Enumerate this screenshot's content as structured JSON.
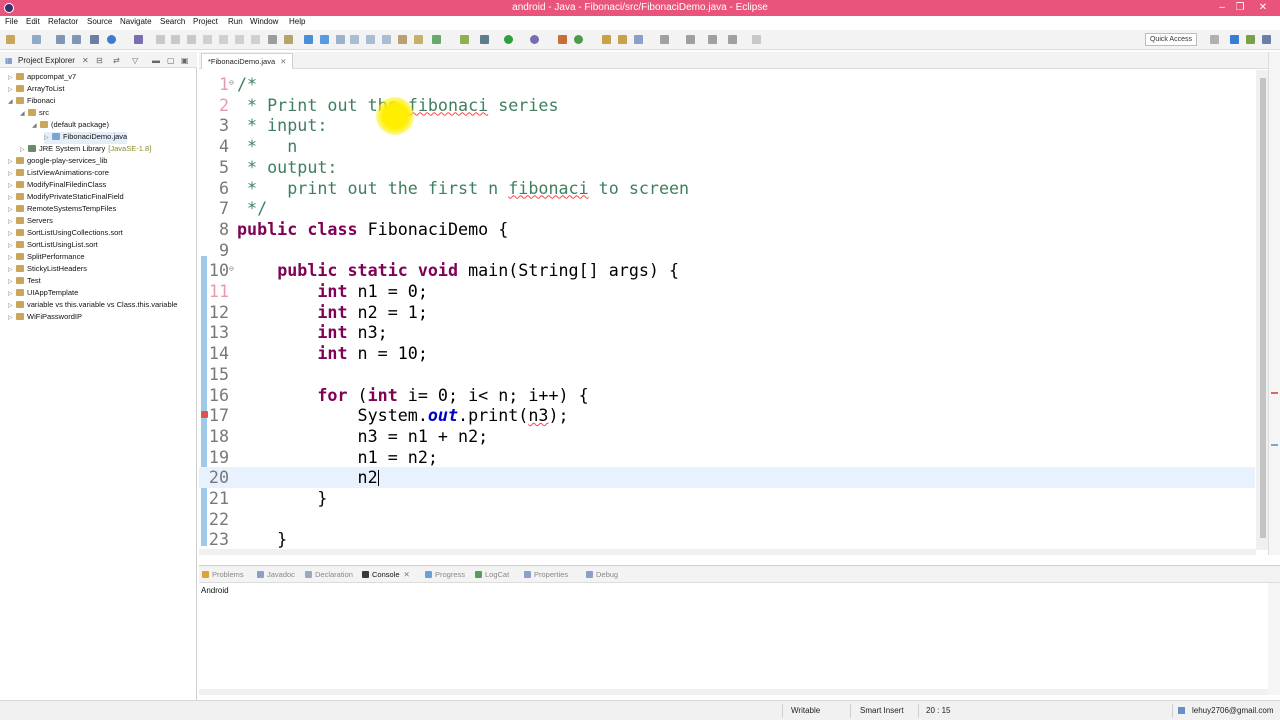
{
  "window": {
    "title": "android - Java - Fibonaci/src/FibonaciDemo.java - Eclipse",
    "controls": [
      "–",
      "❐",
      "✕"
    ],
    "accent": "#e9547c"
  },
  "menu": [
    "File",
    "Edit",
    "Refactor",
    "Source",
    "Navigate",
    "Search",
    "Project",
    "Run",
    "Window",
    "Help"
  ],
  "toolbar": {
    "quick_access": "Quick Access"
  },
  "explorer": {
    "title": "Project Explorer",
    "items": [
      {
        "label": "appcompat_v7",
        "indent": 0,
        "tw": "▷"
      },
      {
        "label": "ArrayToList",
        "indent": 0,
        "tw": "▷"
      },
      {
        "label": "Fibonaci",
        "indent": 0,
        "tw": "◢"
      },
      {
        "label": "src",
        "indent": 1,
        "tw": "◢"
      },
      {
        "label": "(default package)",
        "indent": 2,
        "tw": "◢"
      },
      {
        "label": "FibonaciDemo.java",
        "indent": 3,
        "tw": "▷"
      },
      {
        "label": "JRE System Library",
        "suffix": "[JavaSE-1.8]",
        "indent": 1,
        "tw": "▷"
      },
      {
        "label": "google-play-services_lib",
        "indent": 0,
        "tw": "▷"
      },
      {
        "label": "ListViewAnimations-core",
        "indent": 0,
        "tw": "▷"
      },
      {
        "label": "ModifyFinalFiledinClass",
        "indent": 0,
        "tw": "▷"
      },
      {
        "label": "ModifyPrivateStaticFinalField",
        "indent": 0,
        "tw": "▷"
      },
      {
        "label": "RemoteSystemsTempFiles",
        "indent": 0,
        "tw": "▷"
      },
      {
        "label": "Servers",
        "indent": 0,
        "tw": "▷"
      },
      {
        "label": "SortListUsingCollections.sort",
        "indent": 0,
        "tw": "▷"
      },
      {
        "label": "SortListUsingList.sort",
        "indent": 0,
        "tw": "▷"
      },
      {
        "label": "SplitPerformance",
        "indent": 0,
        "tw": "▷"
      },
      {
        "label": "StickyListHeaders",
        "indent": 0,
        "tw": "▷"
      },
      {
        "label": "Test",
        "indent": 0,
        "tw": "▷"
      },
      {
        "label": "UIAppTemplate",
        "indent": 0,
        "tw": "▷"
      },
      {
        "label": "variable vs this.variable vs Class.this.variable",
        "indent": 0,
        "tw": "▷"
      },
      {
        "label": "WiFiPasswordIP",
        "indent": 0,
        "tw": "▷"
      }
    ]
  },
  "editor": {
    "tab_label": "*FibonaciDemo.java",
    "tab_close": "✕",
    "lines": [
      {
        "n": "1",
        "fold": "⊖",
        "html": "<span class=\"cm\">/*</span>"
      },
      {
        "n": "2",
        "html": "<span class=\"cm\"> * Print out the <span class=\"sq\">fibonaci</span> series</span>"
      },
      {
        "n": "3",
        "html": "<span class=\"cm\"> * input:</span>"
      },
      {
        "n": "4",
        "html": "<span class=\"cm\"> *   n</span>"
      },
      {
        "n": "5",
        "html": "<span class=\"cm\"> * output:</span>"
      },
      {
        "n": "6",
        "html": "<span class=\"cm\"> *   print out the first n <span class=\"sq\">fibonaci</span> to screen</span>"
      },
      {
        "n": "7",
        "html": "<span class=\"cm\"> */</span>"
      },
      {
        "n": "8",
        "html": "<span class=\"kw\">public</span> <span class=\"kw\">class</span> FibonaciDemo {"
      },
      {
        "n": "9",
        "html": ""
      },
      {
        "n": "10",
        "fold": "⊖",
        "html": "    <span class=\"kw\">public</span> <span class=\"kw\">static</span> <span class=\"kw\">void</span> main(String[] args) {"
      },
      {
        "n": "11",
        "html": "        <span class=\"kw\">int</span> n1 = 0;"
      },
      {
        "n": "12",
        "html": "        <span class=\"kw\">int</span> n2 = 1;"
      },
      {
        "n": "13",
        "html": "        <span class=\"kw\">int</span> n3;"
      },
      {
        "n": "14",
        "html": "        <span class=\"kw\">int</span> n = 10;"
      },
      {
        "n": "15",
        "html": ""
      },
      {
        "n": "16",
        "html": "        <span class=\"kw\">for</span> (<span class=\"kw\">int</span> i= 0; i&lt; n; i++) {"
      },
      {
        "n": "17",
        "marker": "error",
        "html": "            System.<span class=\"fld\">out</span>.print(<span class=\"sq\">n3</span>);"
      },
      {
        "n": "18",
        "html": "            n3 = n1 + n2;"
      },
      {
        "n": "19",
        "html": "            n1 = n2;"
      },
      {
        "n": "20",
        "current": true,
        "html": "            n2<span class=\"caret\"></span>"
      },
      {
        "n": "21",
        "html": "        }"
      },
      {
        "n": "22",
        "html": ""
      },
      {
        "n": "23",
        "html": "    }"
      }
    ]
  },
  "console": {
    "tabs": [
      {
        "label": "Problems",
        "color": "#d9a43b"
      },
      {
        "label": "Javadoc",
        "color": "#8aa0c8"
      },
      {
        "label": "Declaration",
        "color": "#9aa9c2"
      },
      {
        "label": "Console",
        "color": "#3a3a3a",
        "active": true
      },
      {
        "label": "Progress",
        "color": "#6aa0d8"
      },
      {
        "label": "LogCat",
        "color": "#5b9b5b"
      },
      {
        "label": "Properties",
        "color": "#8aa0c8"
      },
      {
        "label": "Debug",
        "color": "#8aa0c8"
      }
    ],
    "output": "Android"
  },
  "status": {
    "mode": "Writable",
    "insert": "Smart Insert",
    "position": "20 : 15",
    "user": "lehuy2706@gmail.com"
  }
}
